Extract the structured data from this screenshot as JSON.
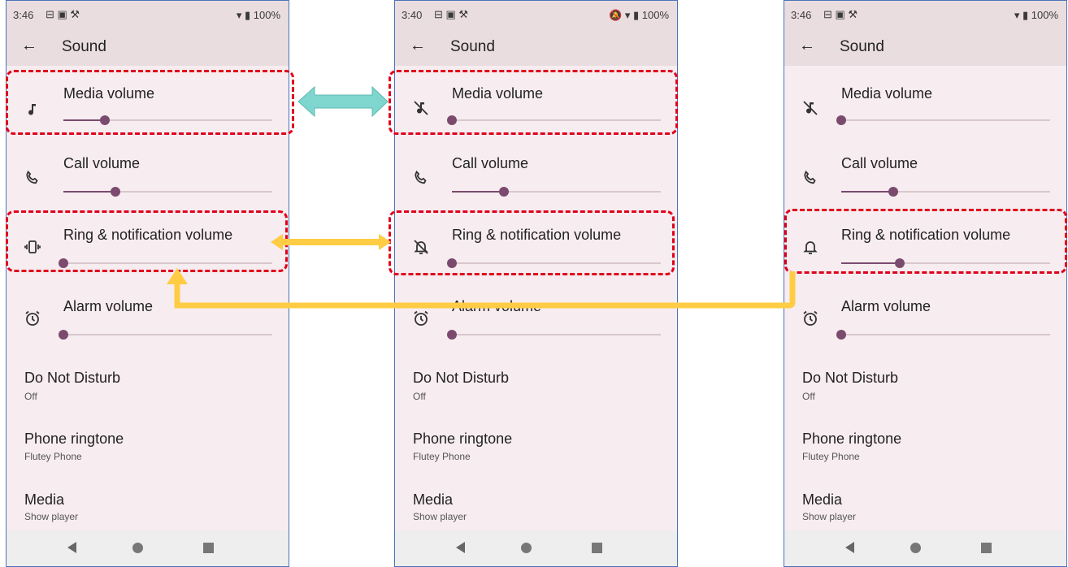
{
  "phones": [
    {
      "status": {
        "time": "3:46",
        "battery": "100%",
        "right_icons": "▾ ▮"
      },
      "title": "Sound",
      "volumes": [
        {
          "label": "Media volume",
          "icon": "music-note-icon",
          "level": 0.2
        },
        {
          "label": "Call volume",
          "icon": "phone-icon",
          "level": 0.25
        },
        {
          "label": "Ring & notification volume",
          "icon": "vibrate-icon",
          "level": 0.0
        },
        {
          "label": "Alarm volume",
          "icon": "alarm-icon",
          "level": 0.0
        }
      ],
      "prefs": [
        {
          "title": "Do Not Disturb",
          "subtitle": "Off"
        },
        {
          "title": "Phone ringtone",
          "subtitle": "Flutey Phone"
        },
        {
          "title": "Media",
          "subtitle": "Show player"
        }
      ]
    },
    {
      "status": {
        "time": "3:40",
        "battery": "100%",
        "right_icons": "🔕 ▾ ▮"
      },
      "title": "Sound",
      "volumes": [
        {
          "label": "Media volume",
          "icon": "music-off-icon",
          "level": 0.0
        },
        {
          "label": "Call volume",
          "icon": "phone-icon",
          "level": 0.25
        },
        {
          "label": "Ring & notification volume",
          "icon": "bell-off-icon",
          "level": 0.0
        },
        {
          "label": "Alarm volume",
          "icon": "alarm-icon",
          "level": 0.0
        }
      ],
      "prefs": [
        {
          "title": "Do Not Disturb",
          "subtitle": "Off"
        },
        {
          "title": "Phone ringtone",
          "subtitle": "Flutey Phone"
        },
        {
          "title": "Media",
          "subtitle": "Show player"
        }
      ]
    },
    {
      "status": {
        "time": "3:46",
        "battery": "100%",
        "right_icons": "▾ ▮"
      },
      "title": "Sound",
      "volumes": [
        {
          "label": "Media volume",
          "icon": "music-off-icon",
          "level": 0.0
        },
        {
          "label": "Call volume",
          "icon": "phone-icon",
          "level": 0.25
        },
        {
          "label": "Ring & notification volume",
          "icon": "bell-icon",
          "level": 0.28
        },
        {
          "label": "Alarm volume",
          "icon": "alarm-icon",
          "level": 0.0
        }
      ],
      "prefs": [
        {
          "title": "Do Not Disturb",
          "subtitle": "Off"
        },
        {
          "title": "Phone ringtone",
          "subtitle": "Flutey Phone"
        },
        {
          "title": "Media",
          "subtitle": "Show player"
        }
      ]
    }
  ],
  "colors": {
    "highlight": "#e0001b",
    "arrow_media": "#7fd6cf",
    "arrow_ring": "#ffcc44",
    "accent": "#7a4b6e"
  }
}
